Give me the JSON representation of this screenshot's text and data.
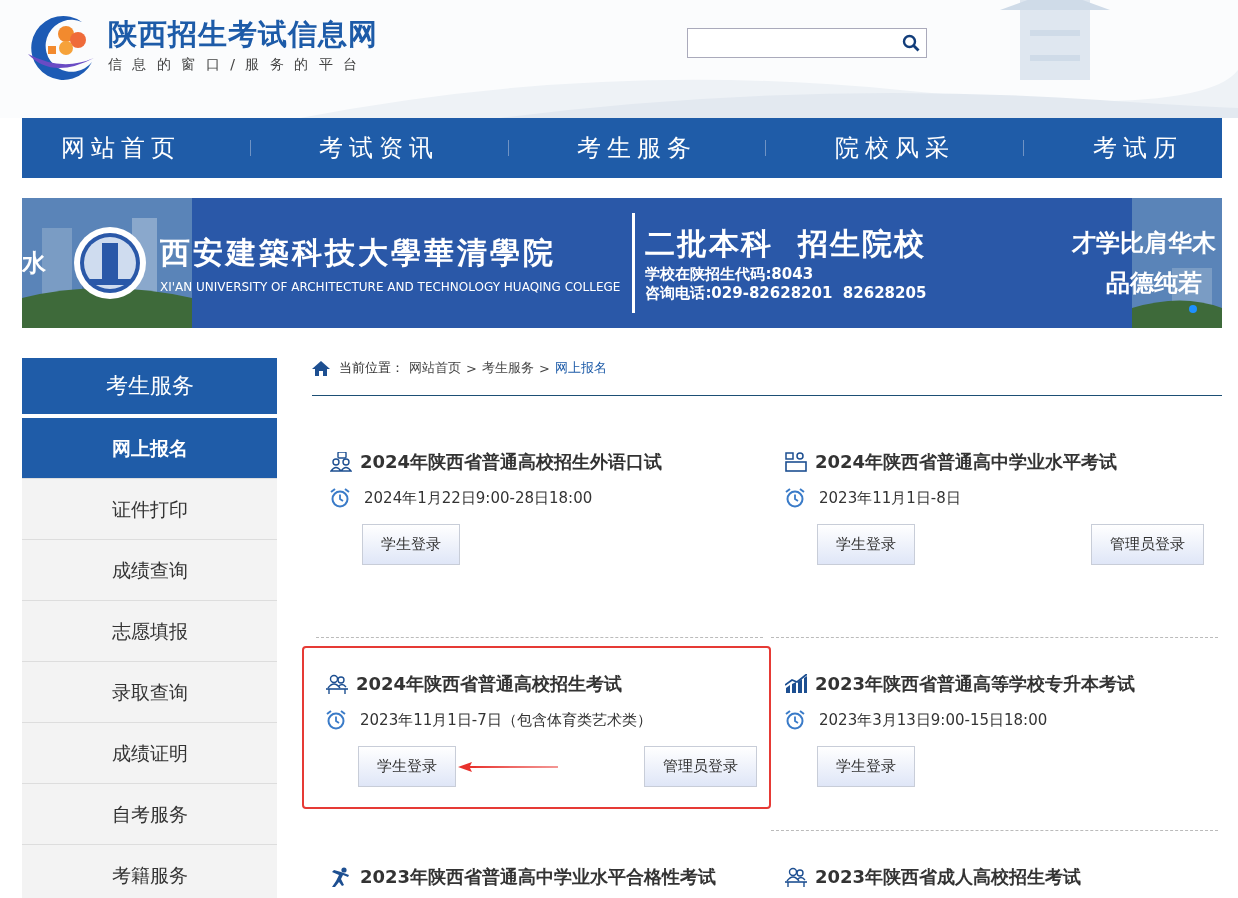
{
  "site": {
    "title": "陕西招生考试信息网",
    "slogan": "信 息 的 窗 口 / 服 务 的 平 台"
  },
  "nav": [
    {
      "label": "网站首页",
      "selected": false
    },
    {
      "label": "考试资讯",
      "selected": false
    },
    {
      "label": "考生服务",
      "selected": false
    },
    {
      "label": "院校风采",
      "selected": false
    },
    {
      "label": "考试历",
      "selected": false
    }
  ],
  "banner": {
    "left_edge": "水",
    "school": "西安建築科技大學華清學院",
    "school_en": "XI'AN UNIVERSITY OF ARCHITECTURE AND TECHNOLOGY HUAQING COLLEGE",
    "headline": "二批本科  招生院校",
    "code": "学校在陕招生代码:8043",
    "phone": "咨询电话:029-82628201  82628205",
    "motto_1": "才学比肩华木",
    "motto_2": "品德纯若"
  },
  "sidebar": {
    "title": "考生服务",
    "items": [
      {
        "label": "网上报名",
        "selected": true
      },
      {
        "label": "证件打印",
        "selected": false
      },
      {
        "label": "成绩查询",
        "selected": false
      },
      {
        "label": "志愿填报",
        "selected": false
      },
      {
        "label": "录取查询",
        "selected": false
      },
      {
        "label": "成绩证明",
        "selected": false
      },
      {
        "label": "自考服务",
        "selected": false
      },
      {
        "label": "考籍服务",
        "selected": false
      }
    ]
  },
  "breadcrumb": {
    "prefix": "当前位置：",
    "separator": ">",
    "items": [
      {
        "label": "网站首页",
        "selected": false
      },
      {
        "label": "考生服务",
        "selected": false
      },
      {
        "label": "网上报名",
        "selected": true
      }
    ]
  },
  "exams": [
    {
      "title": "2024年陕西省普通高校招生外语口试",
      "kind": "speech",
      "date": "2024年1月22日9:00-28日18:00",
      "buttons": [
        "学生登录"
      ],
      "highlighted": false
    },
    {
      "title": "2024年陕西省普通高中学业水平考试",
      "kind": "desk",
      "date": "2023年11月1日-8日",
      "buttons": [
        "学生登录",
        "管理员登录"
      ],
      "highlighted": false
    },
    {
      "title": "2024年陕西省普通高校招生考试",
      "kind": "group",
      "date": "2023年11月1日-7日（包含体育类艺术类）",
      "buttons": [
        "学生登录",
        "管理员登录"
      ],
      "highlighted": true
    },
    {
      "title": "2023年陕西省普通高等学校专升本考试",
      "kind": "chart",
      "date": "2023年3月13日9:00-15日18:00",
      "buttons": [
        "学生登录"
      ],
      "highlighted": false
    },
    {
      "title": "2023年陕西省普通高中学业水平合格性考试",
      "kind": "runner",
      "highlighted": false
    },
    {
      "title": "2023年陕西省成人高校招生考试",
      "kind": "group",
      "highlighted": false
    }
  ]
}
